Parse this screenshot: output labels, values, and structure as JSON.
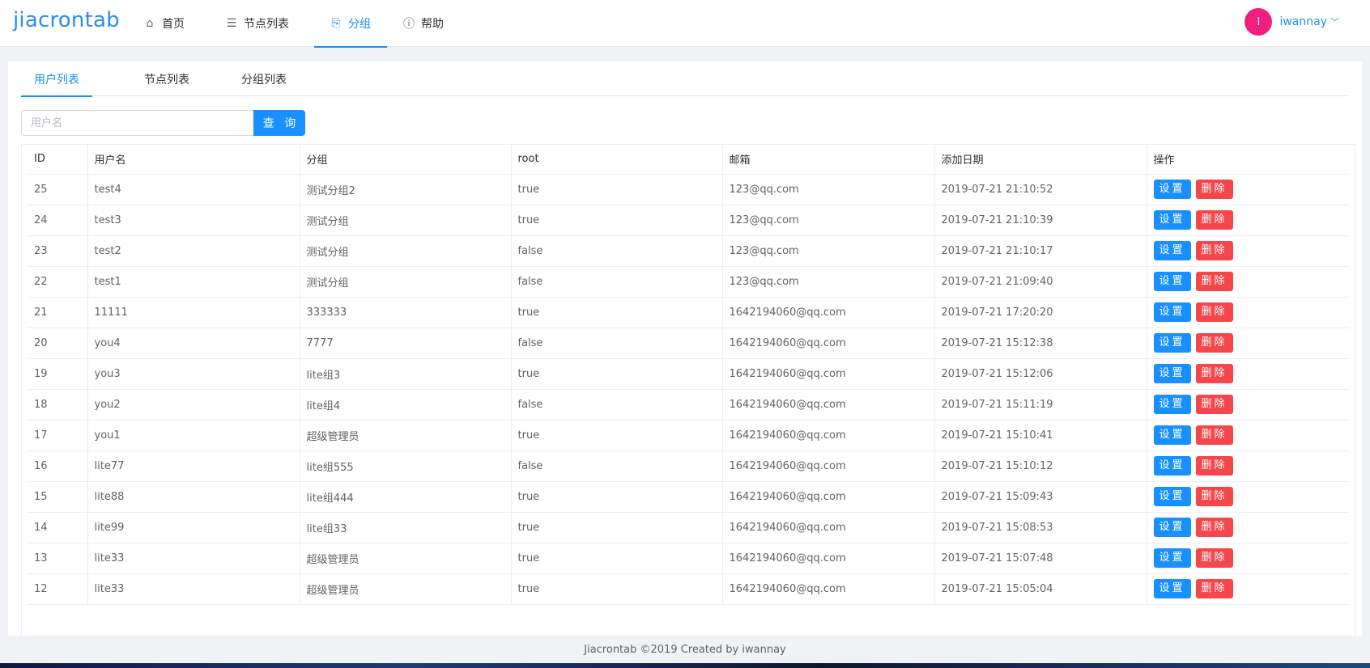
{
  "header": {
    "logo": "jiacrontab",
    "nav": [
      {
        "label": "首页",
        "icon": "home-icon",
        "glyph": "⌂"
      },
      {
        "label": "节点列表",
        "icon": "list-icon",
        "glyph": "☰"
      },
      {
        "label": "分组",
        "icon": "document-icon",
        "glyph": "⎘"
      },
      {
        "label": "帮助",
        "icon": "info-icon",
        "glyph": "ⓘ"
      }
    ],
    "user": {
      "initial": "I",
      "name": "iwannay"
    }
  },
  "tabs": [
    "用户列表",
    "节点列表",
    "分组列表"
  ],
  "search": {
    "placeholder": "用户名",
    "button": "查 询"
  },
  "table": {
    "columns": [
      "ID",
      "用户名",
      "分组",
      "root",
      "邮箱",
      "添加日期",
      "操作"
    ],
    "set_label": "设置",
    "del_label": "删除",
    "rows": [
      [
        "25",
        "test4",
        "测试分组2",
        "true",
        "123@qq.com",
        "2019-07-21 21:10:52"
      ],
      [
        "24",
        "test3",
        "测试分组",
        "true",
        "123@qq.com",
        "2019-07-21 21:10:39"
      ],
      [
        "23",
        "test2",
        "测试分组",
        "false",
        "123@qq.com",
        "2019-07-21 21:10:17"
      ],
      [
        "22",
        "test1",
        "测试分组",
        "false",
        "123@qq.com",
        "2019-07-21 21:09:40"
      ],
      [
        "21",
        "11111",
        "333333",
        "true",
        "1642194060@qq.com",
        "2019-07-21 17:20:20"
      ],
      [
        "20",
        "you4",
        "7777",
        "false",
        "1642194060@qq.com",
        "2019-07-21 15:12:38"
      ],
      [
        "19",
        "you3",
        "lite组3",
        "true",
        "1642194060@qq.com",
        "2019-07-21 15:12:06"
      ],
      [
        "18",
        "you2",
        "lite组4",
        "false",
        "1642194060@qq.com",
        "2019-07-21 15:11:19"
      ],
      [
        "17",
        "you1",
        "超级管理员",
        "true",
        "1642194060@qq.com",
        "2019-07-21 15:10:41"
      ],
      [
        "16",
        "lite77",
        "lite组555",
        "false",
        "1642194060@qq.com",
        "2019-07-21 15:10:12"
      ],
      [
        "15",
        "lite88",
        "lite组444",
        "true",
        "1642194060@qq.com",
        "2019-07-21 15:09:43"
      ],
      [
        "14",
        "lite99",
        "lite组33",
        "true",
        "1642194060@qq.com",
        "2019-07-21 15:08:53"
      ],
      [
        "13",
        "lite33",
        "超级管理员",
        "true",
        "1642194060@qq.com",
        "2019-07-21 15:07:48"
      ],
      [
        "12",
        "lite33",
        "超级管理员",
        "true",
        "1642194060@qq.com",
        "2019-07-21 15:05:04"
      ]
    ]
  },
  "footer": "Jiacrontab ©2019 Created by iwannay",
  "colors": {
    "primary": "#1890ff",
    "danger": "#f5474b",
    "avatar": "#f01e7e"
  }
}
